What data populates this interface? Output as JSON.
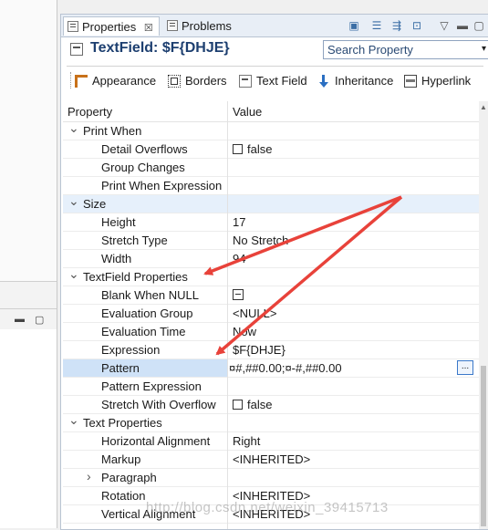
{
  "tabs": [
    {
      "label": "Properties",
      "close": "☒",
      "active": true
    },
    {
      "label": "Problems",
      "active": false
    }
  ],
  "header": {
    "title": "TextField: $F{DHJE}",
    "search_placeholder": "Search Property",
    "search_dropdown": "▾"
  },
  "section_tabs": [
    "Appearance",
    "Borders",
    "Text Field",
    "Inheritance",
    "Hyperlink"
  ],
  "grid": {
    "col_property": "Property",
    "col_value": "Value",
    "rows": [
      {
        "name": "Print When",
        "value": "",
        "level": 0,
        "expander": "expanded",
        "kind": "category"
      },
      {
        "name": "Detail Overflows",
        "value": "false",
        "level": 1,
        "checkbox": true
      },
      {
        "name": "Group Changes",
        "value": "",
        "level": 1
      },
      {
        "name": "Print When Expression",
        "value": "",
        "level": 1
      },
      {
        "name": "Size",
        "value": "",
        "level": 0,
        "expander": "expanded",
        "kind": "category",
        "highlight": true
      },
      {
        "name": "Height",
        "value": "17",
        "level": 1
      },
      {
        "name": "Stretch Type",
        "value": "No Stretch",
        "level": 1
      },
      {
        "name": "Width",
        "value": "94",
        "level": 1
      },
      {
        "name": "TextField Properties",
        "value": "",
        "level": 0,
        "expander": "expanded",
        "kind": "category"
      },
      {
        "name": "Blank When NULL",
        "value": "",
        "level": 1,
        "minusbox": true
      },
      {
        "name": "Evaluation Group",
        "value": "<NULL>",
        "level": 1
      },
      {
        "name": "Evaluation Time",
        "value": "Now",
        "level": 1
      },
      {
        "name": "Expression",
        "value": "$F{DHJE}",
        "level": 1
      },
      {
        "name": "Pattern",
        "value": "¤#,##0.00;¤-#,##0.00",
        "level": 1,
        "selected": true,
        "button": "..."
      },
      {
        "name": "Pattern Expression",
        "value": "",
        "level": 1
      },
      {
        "name": "Stretch With Overflow",
        "value": "false",
        "level": 1,
        "checkbox": true
      },
      {
        "name": "Text Properties",
        "value": "",
        "level": 0,
        "expander": "expanded",
        "kind": "category"
      },
      {
        "name": "Horizontal Alignment",
        "value": "Right",
        "level": 1
      },
      {
        "name": "Markup",
        "value": "<INHERITED>",
        "level": 1
      },
      {
        "name": "Paragraph",
        "value": "",
        "level": 1,
        "expander": "collapsed"
      },
      {
        "name": "Rotation",
        "value": "<INHERITED>",
        "level": 1
      },
      {
        "name": "Vertical Alignment",
        "value": "<INHERITED>",
        "level": 1
      }
    ]
  },
  "watermark": "http://blog.csdn.net/weixin_39415713",
  "colors": {
    "accent": "#1d3f70",
    "category_highlight": "#e6f0fb",
    "selection": "#cfe2f7",
    "arrow": "#e8423a"
  }
}
